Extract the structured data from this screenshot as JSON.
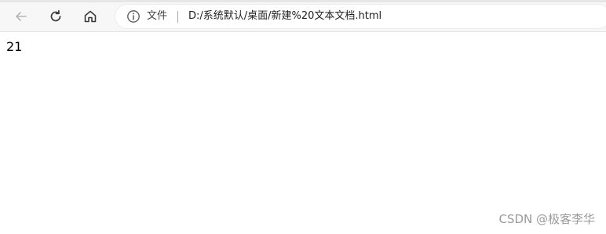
{
  "toolbar": {
    "back_icon": "back-arrow-icon",
    "refresh_icon": "refresh-icon",
    "home_icon": "home-icon"
  },
  "address_bar": {
    "info_icon": "info-icon",
    "scheme_label": "文件",
    "url": "D:/系统默认/桌面/新建%20文本文档.html"
  },
  "page": {
    "output_text": "21"
  },
  "watermark": {
    "text": "CSDN @极客李华"
  },
  "colors": {
    "toolbar_bg": "#f7f7f7",
    "address_bg": "#ffffff",
    "icon_color": "#3a3a3a",
    "disabled_icon": "#b5b5b5",
    "watermark": "#9a9a9a"
  }
}
